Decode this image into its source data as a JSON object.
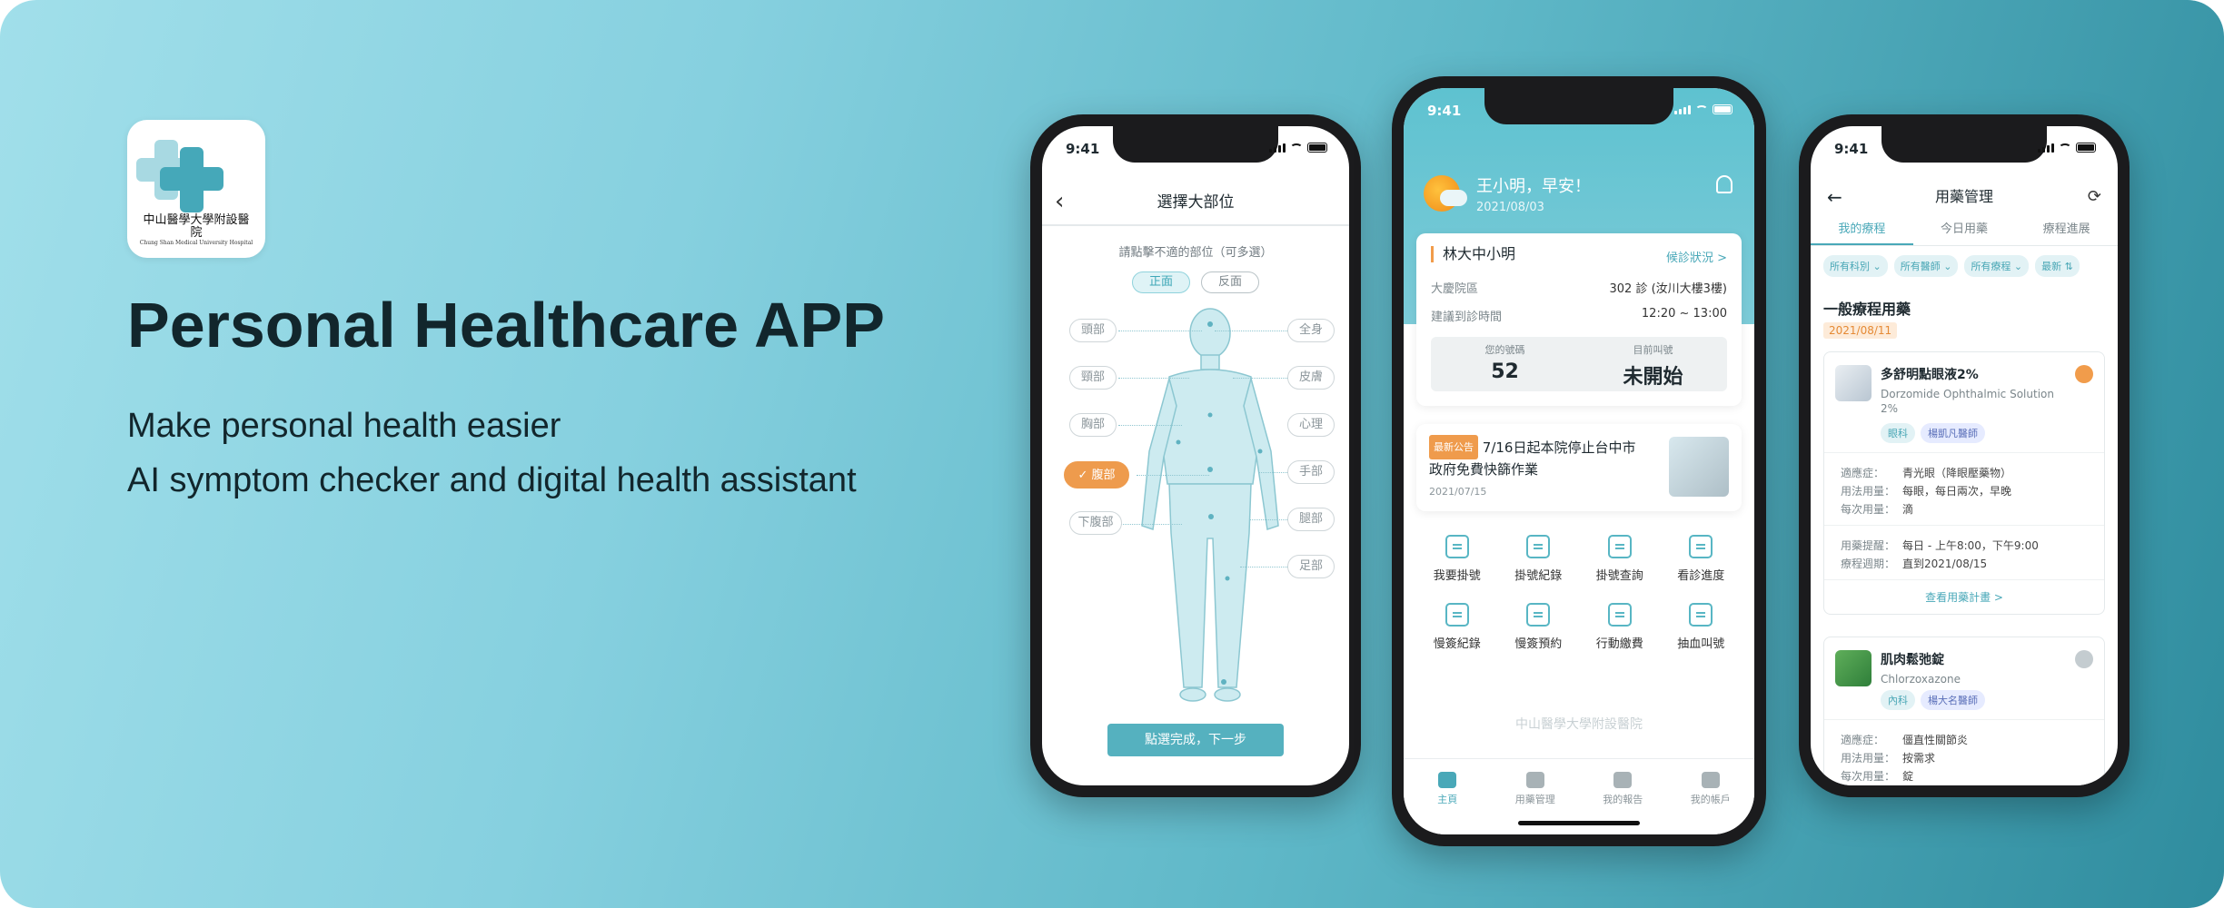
{
  "hero": {
    "title": "Personal Healthcare APP",
    "subtitle_1": "Make personal health easier",
    "subtitle_2": "AI symptom checker and digital health assistant",
    "logo_name": "中山醫學大學附設醫院",
    "logo_en": "Chung Shan Medical University Hospital"
  },
  "status": {
    "time": "9:41"
  },
  "body_select": {
    "title": "選擇大部位",
    "hint": "請點擊不適的部位（可多選）",
    "view_front": "正面",
    "view_back": "反面",
    "left_parts": [
      "頭部",
      "頸部",
      "胸部",
      "腹部",
      "下腹部"
    ],
    "right_parts": [
      "全身",
      "皮膚",
      "心理",
      "手部",
      "腿部",
      "足部"
    ],
    "selected_part": "腹部",
    "next_button": "點選完成，下一步"
  },
  "home": {
    "greeting": "王小明，早安！",
    "date": "2021/08/03",
    "appointment": {
      "hospital": "林大中小明",
      "status_link": "候診狀況 >",
      "dept_label": "大慶院區",
      "dept_value": "302 診 (汝川大樓3樓)",
      "time_label": "建議到診時間",
      "time_value": "12:20 ~ 13:00",
      "my_number_label": "您的號碼",
      "my_number": "52",
      "current_label": "目前叫號",
      "current_value": "未開始"
    },
    "news": {
      "tag": "最新公告",
      "text": "7/16日起本院停止台中市政府免費快篩作業",
      "date": "2021/07/15"
    },
    "grid": [
      "我要掛號",
      "掛號紀錄",
      "掛號查詢",
      "看診進度",
      "慢簽紀錄",
      "慢簽預約",
      "行動繳費",
      "抽血叫號"
    ],
    "watermark": "中山醫學大學附設醫院",
    "tabs": [
      "主頁",
      "用藥管理",
      "我的報告",
      "我的帳戶"
    ]
  },
  "medication": {
    "title": "用藥管理",
    "tabs": [
      "我的療程",
      "今日用藥",
      "療程進展"
    ],
    "filters": [
      "所有科別 ⌄",
      "所有醫師 ⌄",
      "所有療程 ⌄",
      "最新 ⇅"
    ],
    "section": "一般療程用藥",
    "date_tag": "2021/08/11",
    "med1": {
      "name": "多舒明點眼液2%",
      "en": "Dorzomide Ophthalmic Solution 2%",
      "tags": [
        "眼科",
        "楊凱凡醫師"
      ],
      "indication_label": "適應症：",
      "indication": "青光眼（降眼壓藥物）",
      "usage_label": "用法用量：",
      "usage": "每眼，每日兩次，早晚",
      "dose_label": "每次用量：",
      "dose": "滴",
      "remind_label": "用藥提醒：",
      "remind": "每日 - 上午8:00，下午9:00",
      "period_label": "療程週期：",
      "period": "直到2021/08/15",
      "link": "查看用藥計畫 >"
    },
    "med2": {
      "name": "肌肉鬆弛錠",
      "en": "Chlorzoxazone",
      "tags": [
        "內科",
        "楊大名醫師"
      ],
      "indication_label": "適應症：",
      "indication": "僵直性關節炎",
      "usage_label": "用法用量：",
      "usage": "按需求",
      "dose_label": "每次用量：",
      "dose": "錠"
    }
  }
}
